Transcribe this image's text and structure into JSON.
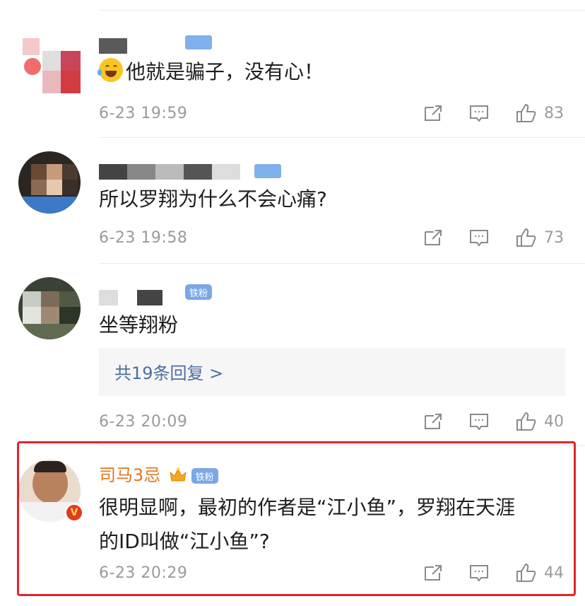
{
  "comments": [
    {
      "text": "他就是骗子，没有心！",
      "time": "6-23 19:59",
      "likes": "83",
      "emoji": "laugh-cry-emoji"
    },
    {
      "text": "所以罗翔为什么不会心痛?",
      "time": "6-23 19:58",
      "likes": "73"
    },
    {
      "text": "坐等翔粉",
      "time": "6-23 20:09",
      "likes": "40",
      "badge": "铁粉",
      "reply_link": "共19条回复 >"
    },
    {
      "username": "司马3忌",
      "badge": "铁粉",
      "text_line1": "很明显啊，最初的作者是“江小鱼”，罗翔在天涯",
      "text_line2": "的ID叫做“江小鱼”?",
      "time": "6-23 20:29",
      "likes": "44"
    }
  ],
  "colors": {
    "username": "#e0781f",
    "highlight_border": "#e0262a",
    "link": "#4a6fa0",
    "meta": "#9a9a9a"
  }
}
